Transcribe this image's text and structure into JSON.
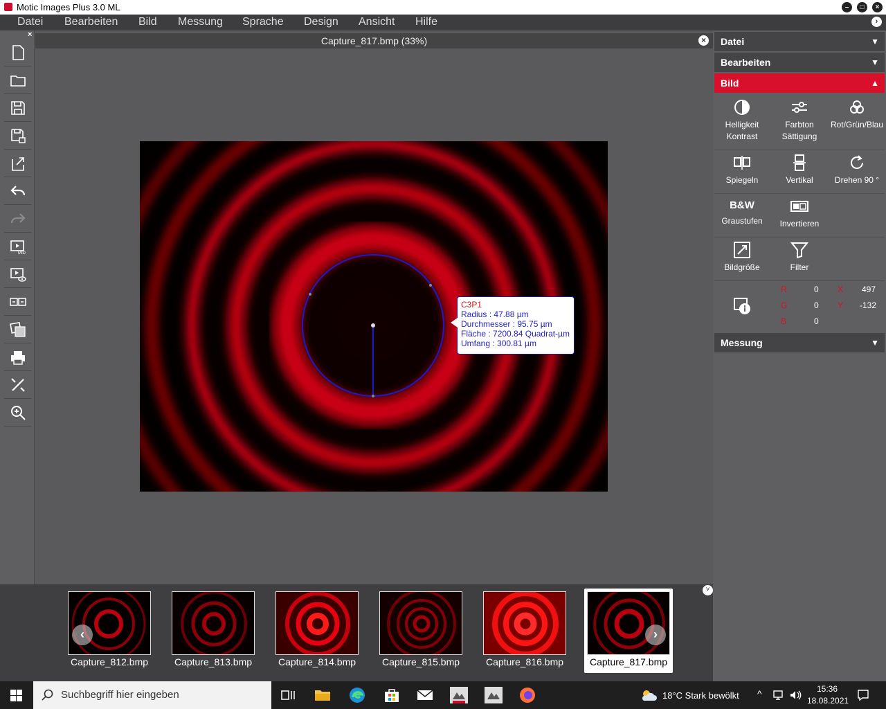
{
  "window": {
    "title": "Motic Images Plus 3.0 ML"
  },
  "menu": [
    "Datei",
    "Bearbeiten",
    "Bild",
    "Messung",
    "Sprache",
    "Design",
    "Ansicht",
    "Hilfe"
  ],
  "image": {
    "title": "Capture_817.bmp (33%)"
  },
  "measurement": {
    "name": "C3P1",
    "radius": "Radius : 47.88 µm",
    "diameter": "Durchmesser : 95.75 µm",
    "area": "Fläche : 7200.84 Quadrat-µm",
    "perimeter": "Umfang : 300.81 µm"
  },
  "panel": {
    "sections": {
      "datei": "Datei",
      "bearbeiten": "Bearbeiten",
      "bild": "Bild",
      "messung": "Messung"
    },
    "buttons": {
      "helligkeit": [
        "Helligkeit",
        "Kontrast"
      ],
      "farbton": [
        "Farbton",
        "Sättigung"
      ],
      "rgb": "Rot/Grün/Blau",
      "spiegeln": "Spiegeln",
      "vertikal": "Vertikal",
      "drehen": "Drehen 90 °",
      "bw_glyph": "B&W",
      "graustufen": "Graustufen",
      "invertieren": "Invertieren",
      "bildgroesse": "Bildgröße",
      "filter": "Filter"
    },
    "pixel": {
      "r_label": "R",
      "g_label": "G",
      "b_label": "B",
      "r": "0",
      "g": "0",
      "b": "0",
      "x_label": "X",
      "y_label": "Y",
      "x": "497",
      "y": "-132"
    }
  },
  "thumbnails": [
    "Capture_812.bmp",
    "Capture_813.bmp",
    "Capture_814.bmp",
    "Capture_815.bmp",
    "Capture_816.bmp",
    "Capture_817.bmp"
  ],
  "taskbar": {
    "search_placeholder": "Suchbegriff hier eingeben",
    "weather": "18°C  Stark bewölkt",
    "time": "15:36",
    "date": "18.08.2021"
  }
}
